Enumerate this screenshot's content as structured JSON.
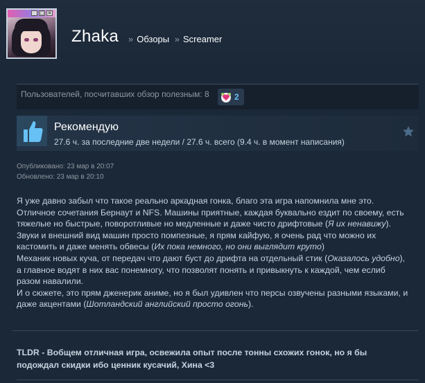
{
  "profile": {
    "username": "Zhaka",
    "breadcrumb_sep": "»",
    "reviews_label": "Обзоры",
    "game_label": "Screamer",
    "avatar_window_buttons": [
      "_",
      "□",
      "✕"
    ]
  },
  "helpful": {
    "text": "Пользователей, посчитавших обзор полезным: 8",
    "award_count": "2"
  },
  "recommendation": {
    "title": "Рекомендую",
    "hours": "27.6 ч. за последние две недели / 27.6 ч. всего (9.4 ч. в момент написания)"
  },
  "dates": {
    "published": "Опубликовано: 23 мар в 20:07",
    "updated": "Обновлено: 23 мар в 20:10"
  },
  "review": {
    "p1_a": "Я уже давно забыл что такое реально аркадная гонка, благо эта игра напомнила мне это. Отличное сочетания Бернаут и NFS. Машины приятные, каждая буквально ездит по своему, есть тяжелые но быстрые, поворотливые но медленные и даже чисто дрифтовые (",
    "p1_i": "Я их ненавижу",
    "p1_b": ").",
    "p2_a": "Звуки и внешний вид машин просто помпезные, я прям кайфую, я очень рад что можно их кастомить и даже менять обвесы (",
    "p2_i": "Их пока немного, но они выглядит круто",
    "p2_b": ")",
    "p3_a": "Механик новых куча, от передач что дают буст до дрифта на отдельный стик (",
    "p3_i": "Оказалось удобно",
    "p3_b": "), а главное водят в них вас понемногу, что позволят понять и привыкнуть к каждой, чем еслиб разом навалили.",
    "p4_a": "И о сюжете, это прям дженерик аниме, но я был удивлен что персы озвучены разными языками, и даже акцентами (",
    "p4_i": "Шотландский английский просто огонь",
    "p4_b": ")."
  },
  "tldr": "TLDR - Вобщем отличная игра, освежила опыт после тонны схожих гонок, но я бы подождал скидки ибо ценник кусачий, Хина <3",
  "colors": {
    "background": "#1b2838",
    "link_blue": "#66c0f4",
    "muted": "#8f98a0",
    "thumb_up": "#67c1f5"
  },
  "icons": [
    "thumbs-up-icon",
    "star-icon",
    "award-heart-icon"
  ]
}
